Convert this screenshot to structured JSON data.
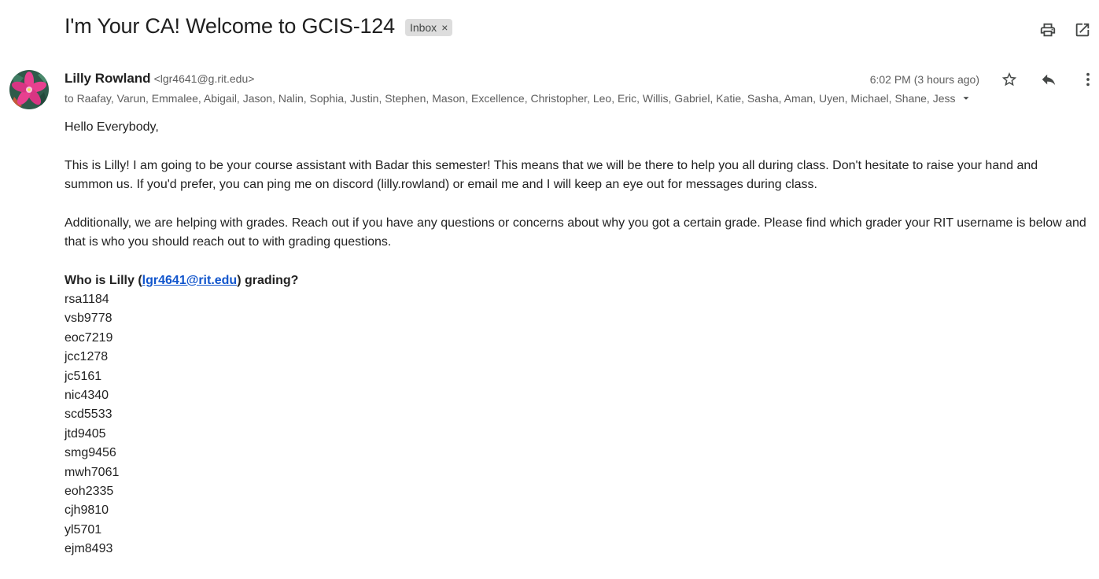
{
  "subject": "I'm Your CA! Welcome to GCIS-124",
  "label": {
    "text": "Inbox",
    "remove_glyph": "×"
  },
  "toolbar": {
    "icons": [
      "print-icon",
      "open-in-new-window-icon"
    ]
  },
  "sender": {
    "name": "Lilly Rowland",
    "email": "<lgr4641@g.rit.edu>",
    "avatar_icon": "flower-avatar"
  },
  "recipients": {
    "text": "to Raafay, Varun, Emmalee, Abigail, Jason, Nalin, Sophia, Justin, Stephen, Mason, Excellence, Christopher, Leo, Eric, Willis, Gabriel, Katie, Sasha, Aman, Uyen, Michael, Shane, Jess"
  },
  "timestamp": "6:02 PM (3 hours ago)",
  "message_actions": [
    "star-icon",
    "reply-icon",
    "more-vert-icon"
  ],
  "body": {
    "greeting": "Hello Everybody,",
    "paragraph1": "This is Lilly! I am going to be your course assistant with Badar this semester! This means that we will be there to help you all during class. Don't hesitate to raise your hand and summon us. If you'd prefer, you can ping me on discord (lilly.rowland) or email me and I will keep an eye out for messages during class.",
    "paragraph2": "Additionally, we are helping with grades. Reach out if you have any questions or concerns about why you got a certain grade. Please find which grader your RIT username is below and that is who you should reach out to with grading questions.",
    "grading_prefix": "Who is Lilly (",
    "grading_link": "lgr4641@rit.edu",
    "grading_suffix": ") grading?",
    "usernames": [
      "rsa1184",
      "vsb9778",
      "eoc7219",
      "jcc1278",
      "jc5161",
      "nic4340",
      "scd5533",
      "jtd9405",
      "smg9456",
      "mwh7061",
      "eoh2335",
      "cjh9810",
      "yl5701",
      "ejm8493"
    ]
  },
  "colors": {
    "link": "#1155cc",
    "chip_bg": "#dddddd",
    "muted_text": "#5e5e5e"
  }
}
